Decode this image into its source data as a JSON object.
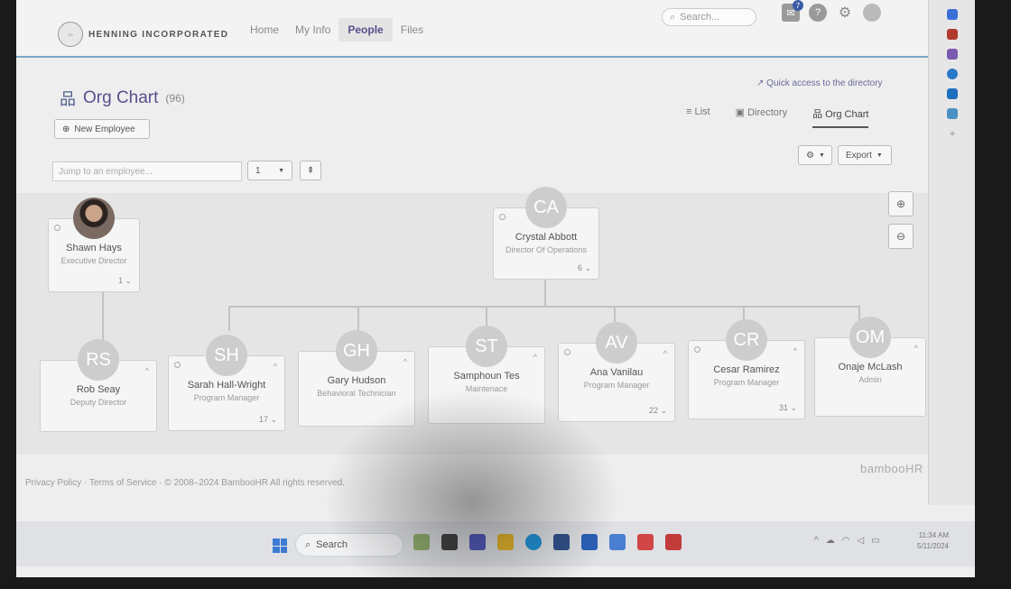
{
  "company": {
    "logo_text": "HENNING INCORPORATED"
  },
  "nav": {
    "items": [
      {
        "label": "Home"
      },
      {
        "label": "My Info"
      },
      {
        "label": "People"
      },
      {
        "label": "Files"
      }
    ],
    "active": "People"
  },
  "search": {
    "placeholder": "Search..."
  },
  "notifications": {
    "count": "7"
  },
  "page": {
    "title": "Org Chart",
    "count": "(96)",
    "new_employee_label": "New Employee",
    "quick_access": "Quick access to the directory",
    "views": [
      {
        "label": "List",
        "icon": "list-icon"
      },
      {
        "label": "Directory",
        "icon": "directory-icon"
      },
      {
        "label": "Org Chart",
        "icon": "org-chart-icon"
      }
    ],
    "active_view": "Org Chart",
    "export_label": "Export",
    "jump_placeholder": "Jump to an employee...",
    "level_value": "1"
  },
  "org": {
    "top_left": {
      "name": "Shawn Hays",
      "title": "Executive Director",
      "count": "1"
    },
    "root": {
      "initials": "CA",
      "name": "Crystal Abbott",
      "title": "Director Of Operations",
      "count": "6"
    },
    "reports": [
      {
        "initials": "RS",
        "name": "Rob Seay",
        "title": "Deputy Director",
        "count": ""
      },
      {
        "initials": "SH",
        "name": "Sarah Hall-Wright",
        "title": "Program Manager",
        "count": "17"
      },
      {
        "initials": "GH",
        "name": "Gary Hudson",
        "title": "Behavioral Technician",
        "count": ""
      },
      {
        "initials": "ST",
        "name": "Samphoun Tes",
        "title": "Maintenace",
        "count": ""
      },
      {
        "initials": "AV",
        "name": "Ana Vanilau",
        "title": "Program Manager",
        "count": "22"
      },
      {
        "initials": "CR",
        "name": "Cesar Ramirez",
        "title": "Program Manager",
        "count": "31"
      },
      {
        "initials": "OM",
        "name": "Onaje McLash",
        "title": "Admin",
        "count": ""
      }
    ]
  },
  "footer": {
    "text": "Privacy Policy · Terms of Service · © 2008–2024 BambooHR All rights reserved.",
    "brand": "bambooHR"
  },
  "taskbar": {
    "search_label": "Search",
    "time": "11:34 AM",
    "date": "5/11/2024"
  },
  "colors": {
    "accent": "#5a4e8c",
    "nav_border": "#7aa7c7",
    "avatar": "#cdcdcd"
  }
}
